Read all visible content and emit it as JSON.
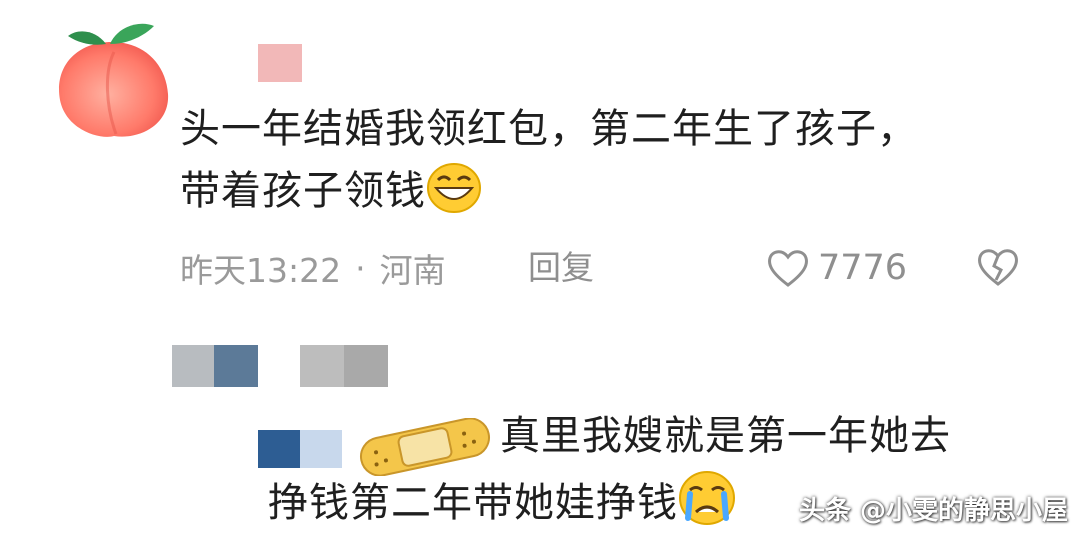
{
  "comment": {
    "avatar_icon": "peach-avatar-icon",
    "text_line1": "头一年结婚我领红包，第二年生了孩子，",
    "text_line2": "带着孩子领钱",
    "emoji_icon": "grinning-face-emoji",
    "time": "昨天13:22",
    "separator": "·",
    "location": "河南",
    "reply_label": "回复",
    "like_icon": "heart-outline-icon",
    "like_count": "7776",
    "dislike_icon": "broken-heart-icon"
  },
  "reply": {
    "sticker_icon": "bandage-sticker-icon",
    "text_line1": "真里我嫂就是第一年她去",
    "text_line2": "挣钱第二年带她娃挣钱",
    "emoji_icon": "crying-face-emoji"
  },
  "watermark": "头条 @小雯的静思小屋",
  "colors": {
    "text": "#1f1f1f",
    "meta": "#9a9a9a",
    "blur_pink": "#f2b8b8",
    "blur_blue": "#2d5d93",
    "blur_gray": "#b5b5b5"
  }
}
